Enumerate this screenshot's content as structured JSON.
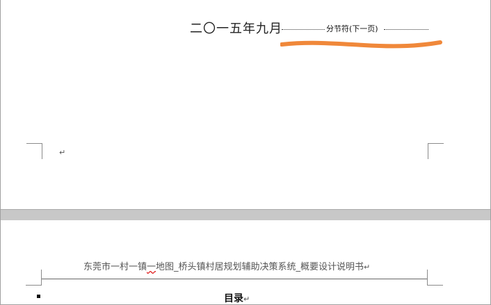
{
  "page1": {
    "date_text": "二〇一五年九月",
    "section_break_label": "分节符(下一页)",
    "paragraph_mark": "↵",
    "highlight_color": "#f0883a"
  },
  "page2": {
    "header_prefix": "东莞市一村一镇",
    "header_squiggle": "一",
    "header_suffix": "地图_桥头镇村居规划辅助决策系统_概要设计说明书",
    "header_mark": "↵",
    "toc_title": "目录",
    "toc_mark": "↵"
  }
}
